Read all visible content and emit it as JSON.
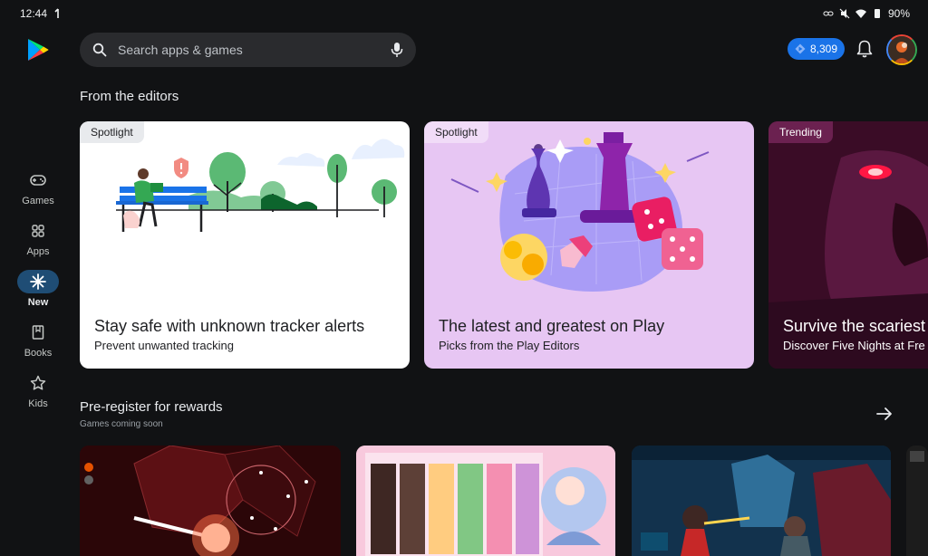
{
  "status_bar": {
    "time": "12:44",
    "battery": "90%"
  },
  "nav": {
    "items": [
      {
        "label": "Games",
        "icon": "gamepad-icon"
      },
      {
        "label": "Apps",
        "icon": "apps-grid-icon"
      },
      {
        "label": "New",
        "icon": "sparkle-icon",
        "active": true
      },
      {
        "label": "Books",
        "icon": "book-icon"
      },
      {
        "label": "Kids",
        "icon": "star-icon"
      }
    ]
  },
  "search": {
    "placeholder": "Search apps & games"
  },
  "header": {
    "points": "8,309"
  },
  "editors": {
    "title": "From the editors",
    "cards": [
      {
        "tag": "Spotlight",
        "title": "Stay safe with unknown tracker alerts",
        "subtitle": "Prevent unwanted tracking"
      },
      {
        "tag": "Spotlight",
        "title": "The latest and greatest on Play",
        "subtitle": "Picks from the Play Editors"
      },
      {
        "tag": "Trending",
        "title": "Survive the scariest",
        "subtitle": "Discover Five Nights at Fre"
      }
    ]
  },
  "preregister": {
    "title": "Pre-register for rewards",
    "subtitle": "Games coming soon"
  },
  "colors": {
    "accent": "#1a73e8",
    "background": "#111214",
    "nav_active": "#1f4d75"
  }
}
